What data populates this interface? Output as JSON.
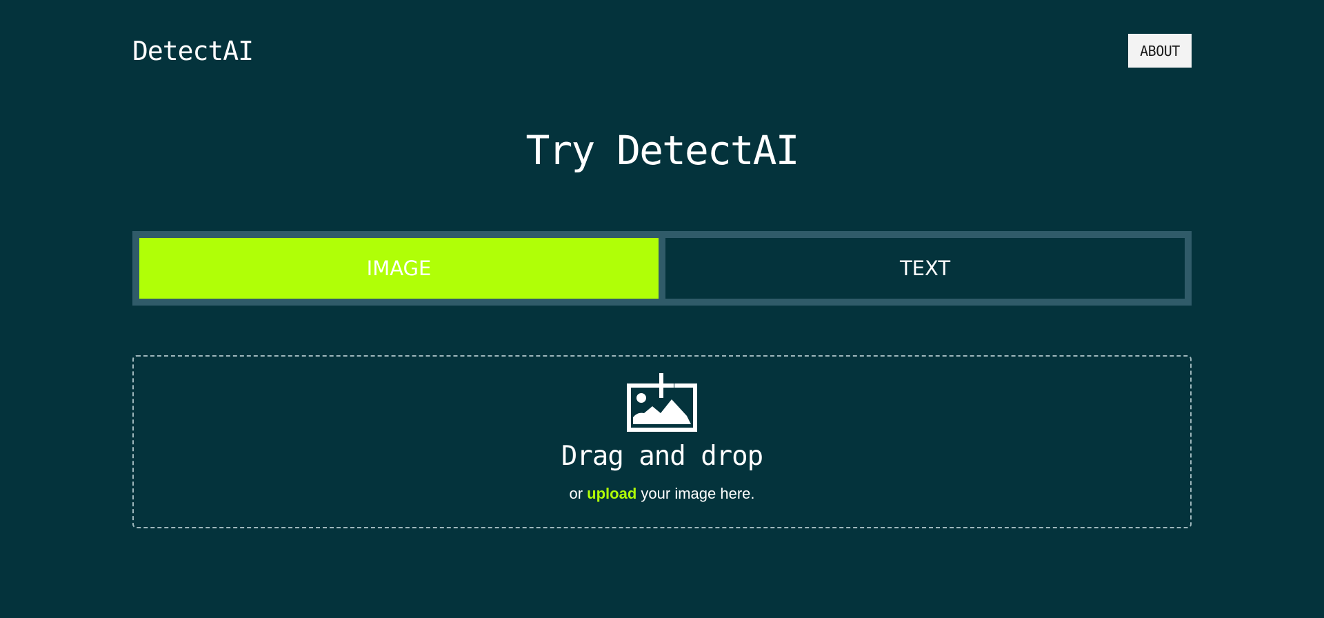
{
  "header": {
    "brand": "DetectAI",
    "about_label": "ABOUT"
  },
  "hero": {
    "title": "Try DetectAI"
  },
  "tabs": [
    {
      "label": "IMAGE",
      "active": true
    },
    {
      "label": "TEXT",
      "active": false
    }
  ],
  "dropzone": {
    "icon": "add-image-icon",
    "title": "Drag and drop",
    "prefix": "or",
    "link_label": "upload",
    "suffix": "your image here."
  },
  "colors": {
    "background": "#04333c",
    "accent": "#b0ff07",
    "tab_frame": "#305b69",
    "about_bg": "#f3f3f3"
  }
}
